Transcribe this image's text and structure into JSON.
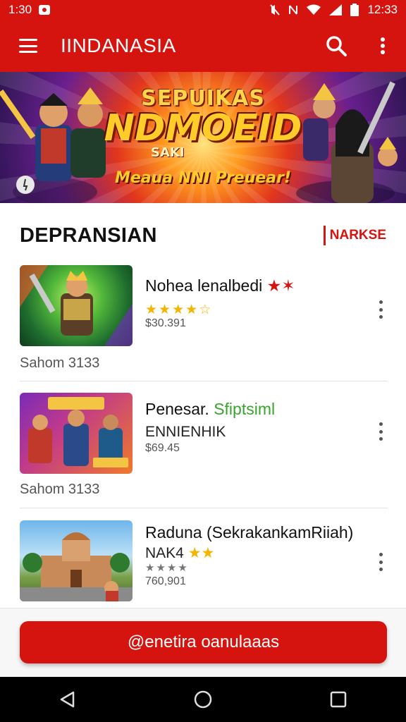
{
  "status_bar": {
    "time_left": "1:30",
    "time_right": "12:33"
  },
  "app_bar": {
    "title": "IINDANASIA"
  },
  "banner": {
    "line1": "SEPUIKAS",
    "line2": "NDMOEID",
    "line3": "SAKI",
    "line4": "Meaua NNI Preuear!"
  },
  "section": {
    "title": "DEPRANSIAN",
    "tag": "NARKSE"
  },
  "items": [
    {
      "title": "Nohea lenalbedi",
      "rating": 4,
      "price": "$30.391",
      "footer": "Sahom 3133"
    },
    {
      "title_main": "Penesar.",
      "title_accent": "Sfiptsiml",
      "subtitle": "ENNIENHIK",
      "price": "$69.45",
      "footer": "Sahom 3133"
    },
    {
      "title": "Raduna (SekrakankamRiiah)",
      "subtitle": "NAK4",
      "rating_grey": 4,
      "price": "760,901"
    }
  ],
  "cta": {
    "label": "@enetira oanulaaas"
  },
  "colors": {
    "brand_red": "#d6140f",
    "star_gold": "#f4b400",
    "accent_green": "#3aa52c"
  }
}
